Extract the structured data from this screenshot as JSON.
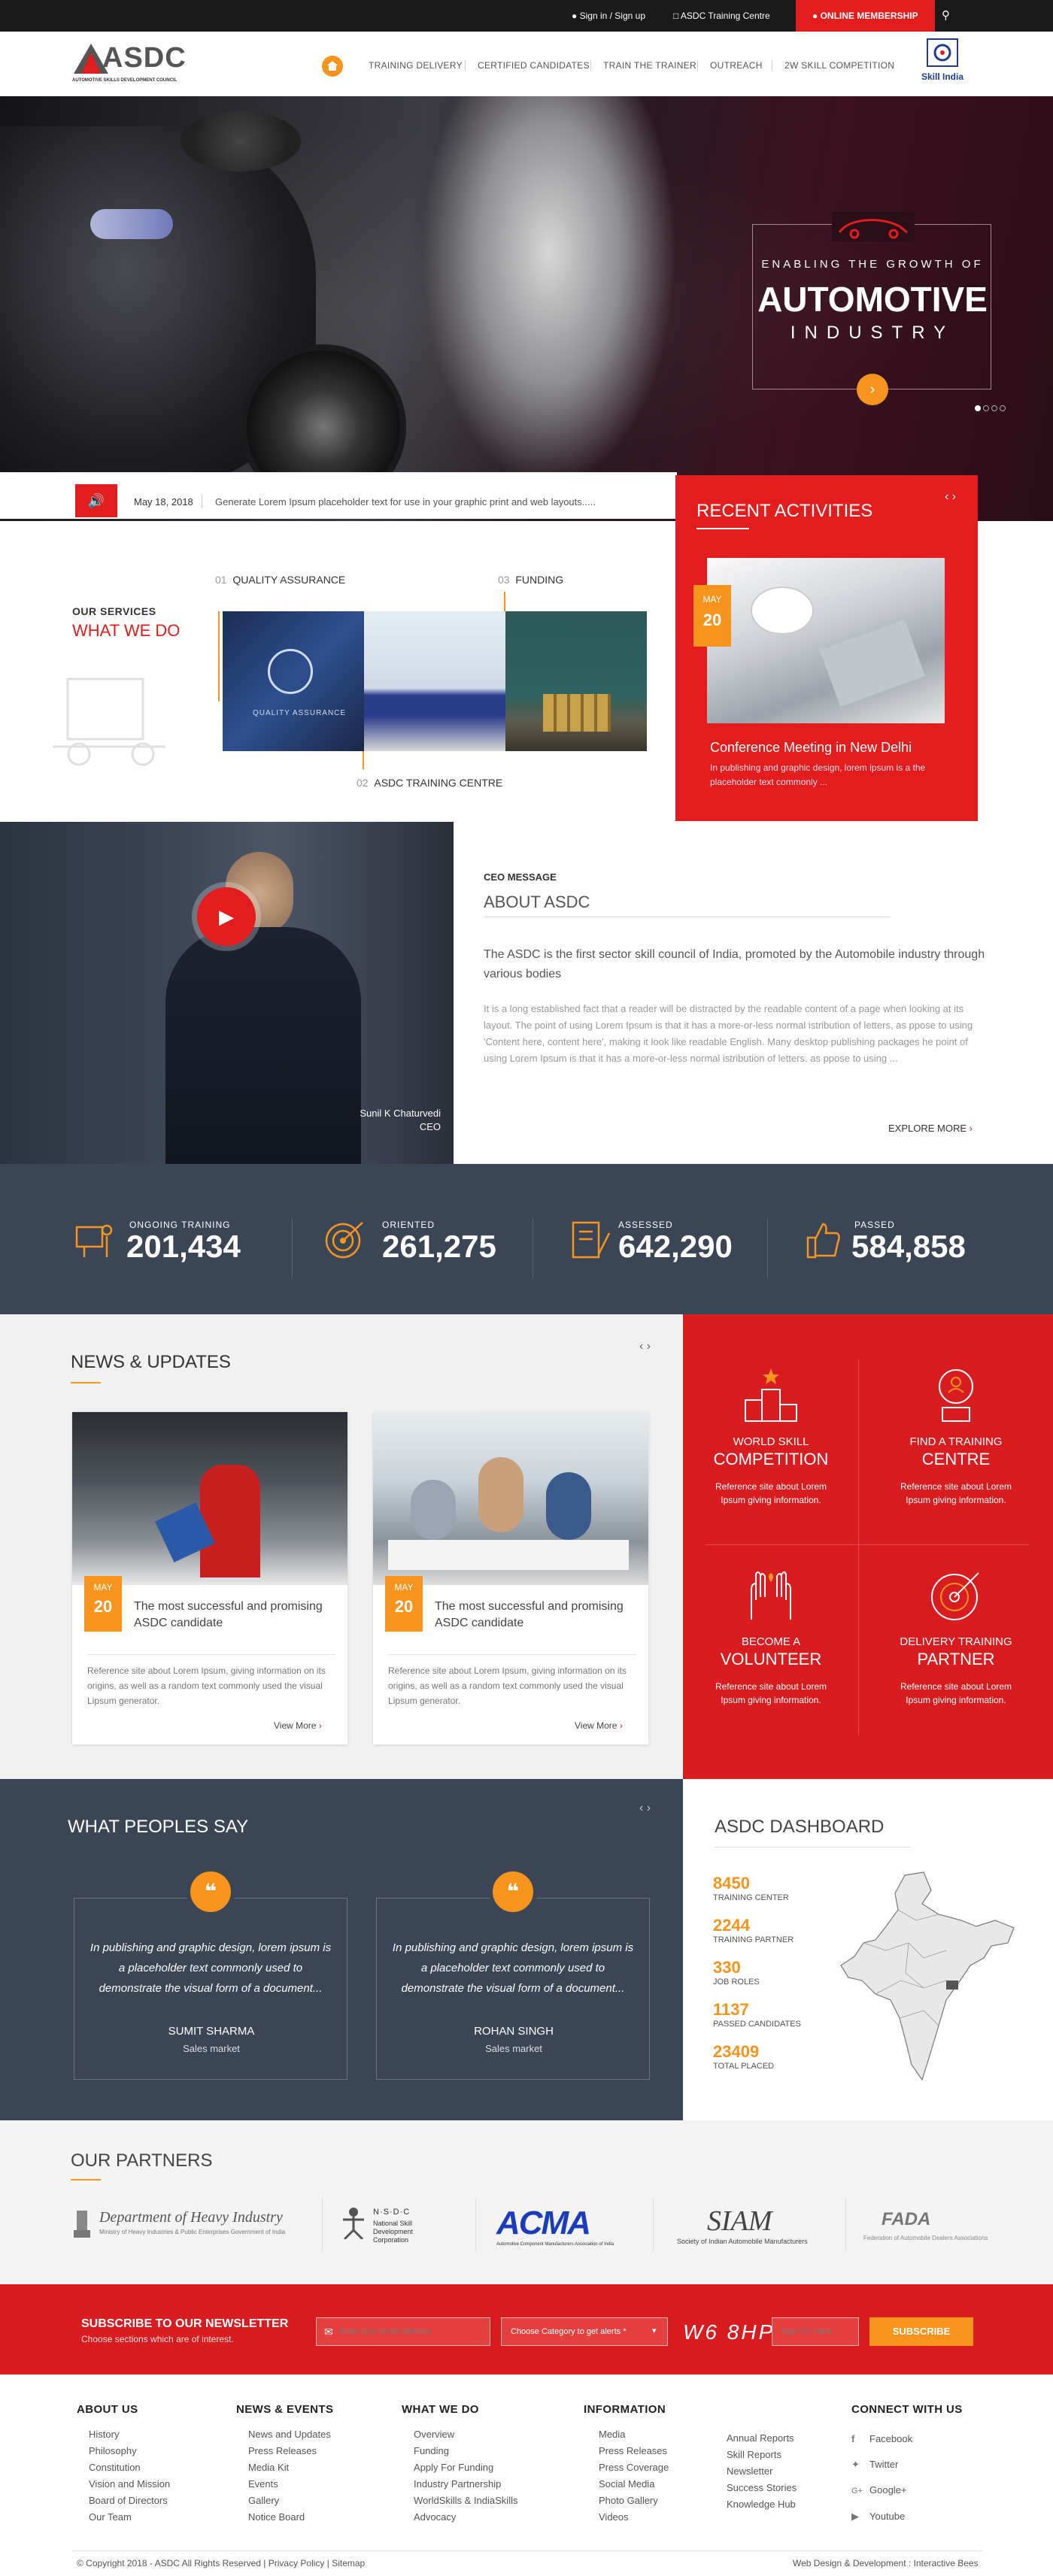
{
  "topbar": {
    "signin": "Sign in / Sign up",
    "training_centre": "ASDC Training Centre",
    "online_membership": "ONLINE MEMBERSHIP"
  },
  "logo": {
    "text": "ASDC",
    "tagline": "AUTOMOTIVE SKILLS DEVELOPMENT COUNCIL"
  },
  "nav": {
    "items": [
      "TRAINING DELIVERY",
      "CERTIFIED CANDIDATES",
      "TRAIN THE TRAINER",
      "OUTREACH",
      "2W SKILL COMPETITION"
    ]
  },
  "skill_india": {
    "text": "Skill India"
  },
  "hero": {
    "line1": "ENABLING THE GROWTH OF",
    "line2": "AUTOMOTIVE",
    "line3": "INDUSTRY"
  },
  "ticker": {
    "date": "May 18, 2018",
    "text": "Generate Lorem Ipsum placeholder text for use in your graphic print and web layouts....."
  },
  "services": {
    "label": "OUR SERVICES",
    "title": "WHAT WE DO",
    "items": [
      {
        "num": "01",
        "label": "QUALITY ASSURANCE"
      },
      {
        "num": "02",
        "label": "ASDC TRAINING CENTRE"
      },
      {
        "num": "03",
        "label": "FUNDING"
      }
    ]
  },
  "recent": {
    "title": "RECENT ACTIVITIES",
    "month": "MAY",
    "day": "20",
    "headline": "Conference Meeting in New Delhi",
    "desc": "In publishing and graphic design, lorem ipsum is a the placeholder text commonly ..."
  },
  "ceo": {
    "label": "CEO MESSAGE",
    "title": "ABOUT ASDC",
    "lead": "The ASDC is the first sector skill council of India, promoted by the Automobile industry through various bodies",
    "body": "It is a long established fact that a reader will be distracted by the readable content of a page when looking at its layout. The point of using Lorem Ipsum is that it has a more-or-less normal istribution of  letters, as ppose to using 'Content here, content here', making it look like readable English. Many desktop publishing packages he point of using Lorem Ipsum is that it has a more-or-less normal istribution of  letters. as ppose to using ...",
    "explore": "EXPLORE MORE",
    "name": "Sunil K Chaturvedi",
    "role": "CEO"
  },
  "stats": [
    {
      "label": "ONGOING TRAINING",
      "value": "201,434"
    },
    {
      "label": "ORIENTED",
      "value": "261,275"
    },
    {
      "label": "ASSESSED",
      "value": "642,290"
    },
    {
      "label": "PASSED",
      "value": "584,858"
    }
  ],
  "news": {
    "title": "NEWS & UPDATES",
    "cards": [
      {
        "month": "MAY",
        "day": "20",
        "title": "The most successful and promising ASDC candidate",
        "desc": "Reference site about Lorem Ipsum, giving information on its origins, as well as a random  text commonly used the visual Lipsum generator.",
        "more": "View More"
      },
      {
        "month": "MAY",
        "day": "20",
        "title": "The most successful and promising ASDC candidate",
        "desc": "Reference site about Lorem Ipsum, giving information on its origins, as well as a random  text commonly used the visual Lipsum generator.",
        "more": "View More"
      }
    ]
  },
  "features": [
    {
      "small": "WORLD SKILL",
      "big": "COMPETITION",
      "desc": "Reference site about Lorem Ipsum giving information."
    },
    {
      "small": "FIND A TRAINING",
      "big": "CENTRE",
      "desc": "Reference site about Lorem Ipsum giving information."
    },
    {
      "small": "BECOME A",
      "big": "VOLUNTEER",
      "desc": "Reference site about Lorem Ipsum giving information."
    },
    {
      "small": "DELIVERY TRAINING",
      "big": "PARTNER",
      "desc": "Reference site about Lorem Ipsum giving information."
    }
  ],
  "testimonials": {
    "title": "WHAT PEOPLES SAY",
    "items": [
      {
        "quote": "In publishing and graphic design, lorem ipsum is a placeholder text commonly used to demonstrate the visual form of a document...",
        "name": "SUMIT SHARMA",
        "role": "Sales market"
      },
      {
        "quote": "In publishing and graphic design, lorem ipsum is a placeholder text commonly used to demonstrate the visual form of a document...",
        "name": "ROHAN SINGH",
        "role": "Sales market"
      }
    ]
  },
  "dashboard": {
    "title": "ASDC DASHBOARD",
    "items": [
      {
        "value": "8450",
        "label": "TRAINING CENTER"
      },
      {
        "value": "2244",
        "label": "TRAINING PARTNER"
      },
      {
        "value": "330",
        "label": "JOB ROLES"
      },
      {
        "value": "1137",
        "label": "PASSED CANDIDATES"
      },
      {
        "value": "23409",
        "label": "TOTAL PLACED"
      }
    ]
  },
  "partners": {
    "title": "OUR PARTNERS",
    "items": [
      {
        "name": "Department of Heavy Industry",
        "sub": "Ministry of Heavy Industries & Public Enterprises  Government of India"
      },
      {
        "name": "N·S·D·C",
        "sub": "National Skill Development Corporation"
      },
      {
        "name": "ACMA",
        "sub": "Automotive Component Manufacturers Association of India"
      },
      {
        "name": "SIAM",
        "sub": "Society of Indian Automobile Manufacturers"
      },
      {
        "name": "FADA",
        "sub": "Federation of Automobile Dealers Associations"
      }
    ]
  },
  "newsletter": {
    "title": "SUBSCRIBE TO OUR NEWSLETTER",
    "sub": "Choose sections which are of interest.",
    "email_placeholder": "Enter your email address",
    "category": "Choose Category to get alerts *",
    "captcha": "W6 8HP",
    "vc_placeholder": "Type VC Here",
    "button": "SUBSCRIBE"
  },
  "footer": {
    "about": {
      "title": "ABOUT US",
      "links": [
        "History",
        "Philosophy",
        "Constitution",
        "Vision and Mission",
        "Board of Directors",
        "Our Team"
      ]
    },
    "news": {
      "title": "NEWS & EVENTS",
      "links": [
        "News and Updates",
        "Press Releases",
        "Media Kit",
        "Events",
        "Gallery",
        "Notice Board"
      ]
    },
    "what": {
      "title": "WHAT WE DO",
      "links": [
        "Overview",
        "Funding",
        "Apply For Funding",
        "Industry Partnership",
        "WorldSkills & IndiaSkills",
        "Advocacy"
      ]
    },
    "info": {
      "title": "INFORMATION",
      "links": [
        "Media",
        "Press Releases",
        "Press Coverage",
        "Social Media",
        "Photo Gallery",
        "Videos"
      ],
      "links2": [
        "Annual Reports",
        "Skill Reports",
        "Newsletter",
        "Success Stories",
        "Knowledge Hub"
      ]
    },
    "connect": {
      "title": "CONNECT WITH US",
      "links": [
        "Facebook",
        "Twitter",
        "Google+",
        "Youtube"
      ]
    },
    "copyright": "© Copyright 2018 - ASDC All Rights Reserved  |  Privacy Policy  |  Sitemap",
    "credit": "Web Design & Development : Interactive Bees"
  },
  "colors": {
    "red": "#e31d1d",
    "orange": "#f7941d",
    "navy": "#3a4556"
  }
}
